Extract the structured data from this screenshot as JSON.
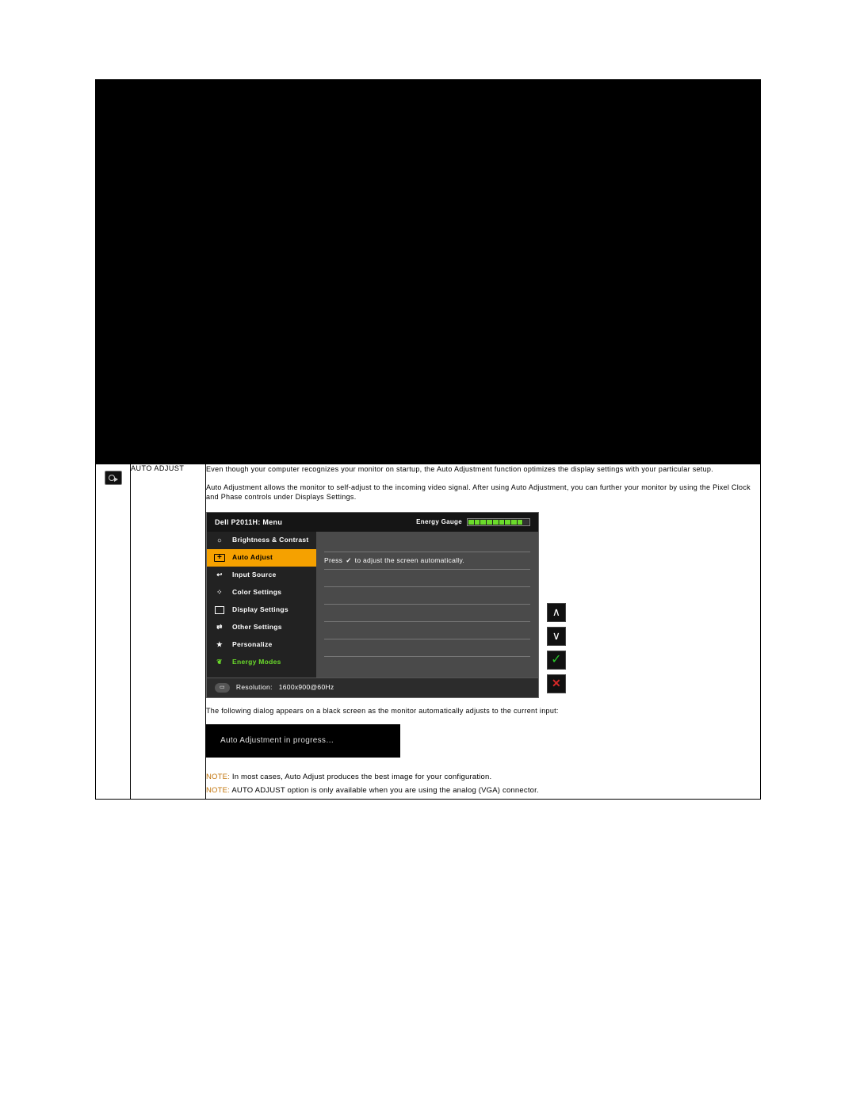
{
  "row2": {
    "label": "AUTO ADJUST",
    "para1": "Even though your computer recognizes your monitor on startup, the Auto Adjustment function optimizes the display settings with your particular setup.",
    "para2": "Auto Adjustment allows the monitor to self-adjust to the incoming video signal. After using Auto Adjustment, you can further your monitor by using the Pixel Clock and Phase controls under Displays Settings.",
    "afterOsd": "The following dialog appears on a black screen as the monitor automatically adjusts to the current input:",
    "dialog": "Auto Adjustment in progress…",
    "note1Label": "NOTE:",
    "note1": " In most cases, Auto Adjust produces the best image for your configuration.",
    "note2Label": "NOTE:",
    "note2": " AUTO ADJUST option is only available when you are using the analog (VGA) connector."
  },
  "osd": {
    "title": "Dell P2011H: Menu",
    "energyLabel": "Energy Gauge",
    "items": [
      {
        "label": "Brightness & Contrast",
        "icon": "bright",
        "active": false
      },
      {
        "label": "Auto Adjust",
        "icon": "auto",
        "active": true
      },
      {
        "label": "Input Source",
        "icon": "input",
        "active": false
      },
      {
        "label": "Color Settings",
        "icon": "color",
        "active": false
      },
      {
        "label": "Display Settings",
        "icon": "display",
        "active": false
      },
      {
        "label": "Other Settings",
        "icon": "other",
        "active": false
      },
      {
        "label": "Personalize",
        "icon": "star",
        "active": false
      },
      {
        "label": "Energy Modes",
        "icon": "leaf",
        "active": false
      }
    ],
    "rightHint1": "Press",
    "rightHint2": "to adjust the screen automatically.",
    "footerBadge": "▭",
    "footerResLabel": "Resolution:",
    "footerRes": "1600x900@60Hz"
  }
}
